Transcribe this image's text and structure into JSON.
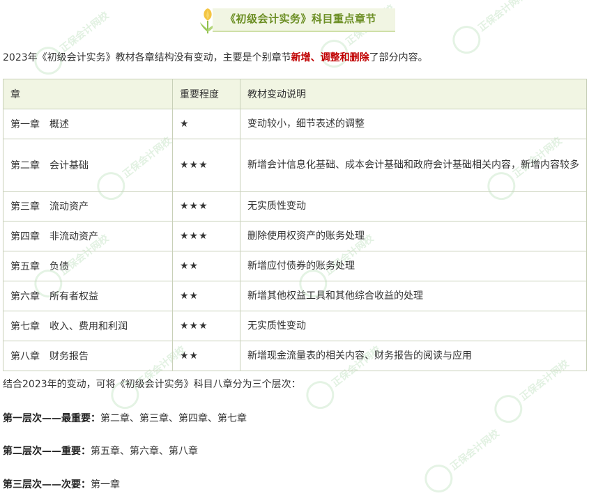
{
  "title": {
    "text": "《初级会计实务》科目重点章节"
  },
  "intro": {
    "prefix": "2023年《初级会计实务》教材各章结构没有变动，主要是个别章节",
    "highlight": "新增、调整和删除",
    "suffix": "了部分内容。"
  },
  "table": {
    "headers": [
      "章",
      "重要程度",
      "教材变动说明"
    ],
    "rows": [
      {
        "chapter": "第一章　概述",
        "importance": "★",
        "desc": "变动较小，细节表述的调整"
      },
      {
        "chapter": "第二章　会计基础",
        "importance": "★★★",
        "desc": "新增会计信息化基础、成本会计基础和政府会计基础相关内容，新增内容较多"
      },
      {
        "chapter": "第三章　流动资产",
        "importance": "★★★",
        "desc": "无实质性变动"
      },
      {
        "chapter": "第四章　非流动资产",
        "importance": "★★★",
        "desc": "删除使用权资产的账务处理"
      },
      {
        "chapter": "第五章　负债",
        "importance": "★★",
        "desc": "新增应付债券的账务处理"
      },
      {
        "chapter": "第六章　所有者权益",
        "importance": "★★",
        "desc": "新增其他权益工具和其他综合收益的处理"
      },
      {
        "chapter": "第七章　收入、费用和利润",
        "importance": "★★★",
        "desc": "无实质性变动"
      },
      {
        "chapter": "第八章　财务报告",
        "importance": "★★",
        "desc": "新增现金流量表的相关内容、财务报告的阅读与应用"
      }
    ]
  },
  "summary": "结合2023年的变动，可将《初级会计实务》科目八章分为三个层次：",
  "levels": [
    {
      "label": "第一层次——最重要：",
      "chapters": "第二章、第三章、第四章、第七章"
    },
    {
      "label": "第二层次——重要：",
      "chapters": "第五章、第六章、第八章"
    },
    {
      "label": "第三层次——次要：",
      "chapters": "第一章"
    }
  ],
  "colors": {
    "accent": "#6b8e23",
    "highlight_red": "#c00000",
    "header_bg": "#f1f5e3",
    "border": "#c8d0b8"
  },
  "watermark": {
    "text": "正保会计网校",
    "icon": "leaf-logo-icon"
  }
}
